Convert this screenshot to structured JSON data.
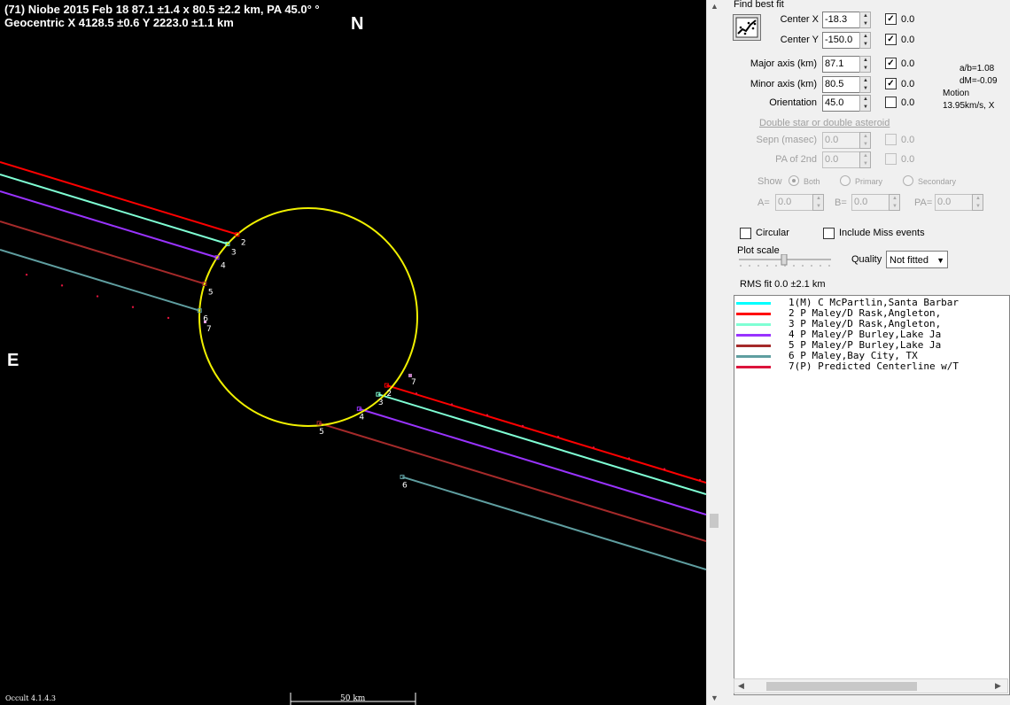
{
  "plot": {
    "title_line1": "(71) Niobe  2015 Feb 18   87.1 ±1.4 x 80.5 ±2.2 km, PA 45.0° °",
    "title_line2": "Geocentric  X  4128.5 ±0.6  Y 2223.0 ±1.1 km",
    "north_label": "N",
    "east_label": "E",
    "version": "Occult 4.1.4.3",
    "scale_label": "50 km",
    "ellipse_color": "#f0f000",
    "chord_labels": [
      "2",
      "3",
      "4",
      "5",
      "6",
      "7"
    ]
  },
  "panel": {
    "section_title": "Find best fit",
    "fit_button_icon": "scatter-fit-icon",
    "center_x": {
      "label": "Center X",
      "value": "-18.3",
      "checked": true,
      "adjust": "0.0"
    },
    "center_y": {
      "label": "Center Y",
      "value": "-150.0",
      "checked": true,
      "adjust": "0.0"
    },
    "major_axis": {
      "label": "Major axis (km)",
      "value": "87.1",
      "checked": true,
      "adjust": "0.0"
    },
    "minor_axis": {
      "label": "Minor axis (km)",
      "value": "80.5",
      "checked": true,
      "adjust": "0.0"
    },
    "orientation": {
      "label": "Orientation",
      "value": "45.0",
      "checked": false,
      "adjust": "0.0"
    },
    "ab_ratio": "a/b=1.08",
    "dm": "dM=-0.09",
    "motion_label": "Motion",
    "motion_value": "13.95km/s, X",
    "double_star_title": "Double star  or  double asteroid",
    "sepn": {
      "label": "Sepn (masec)",
      "value": "0.0",
      "adjust": "0.0"
    },
    "pa_2nd": {
      "label": "PA of 2nd",
      "value": "0.0",
      "adjust": "0.0"
    },
    "show_label": "Show",
    "show_options": [
      "Both",
      "Primary",
      "Secondary"
    ],
    "a_label": "A=",
    "a_value": "0.0",
    "b_label": "B=",
    "b_value": "0.0",
    "pa_label": "PA=",
    "pa_value": "0.0",
    "circular_label": "Circular",
    "include_miss_label": "Include Miss events",
    "plot_scale_label": "Plot scale",
    "quality_label": "Quality",
    "quality_value": "Not fitted",
    "rms_fit": "RMS fit 0.0 ±2.1 km"
  },
  "legend": [
    {
      "text": "1(M)  C McPartlin,Santa Barbar",
      "color": "#00ffff"
    },
    {
      "text": "2     P Maley/D Rask,Angleton,",
      "color": "#ff0000"
    },
    {
      "text": "3     P Maley/D Rask,Angleton,",
      "color": "#7fffd4"
    },
    {
      "text": "4     P Maley/P Burley,Lake Ja",
      "color": "#9933ff"
    },
    {
      "text": "5     P Maley/P Burley,Lake Ja",
      "color": "#a52a2a"
    },
    {
      "text": "6     P Maley,Bay City, TX",
      "color": "#5f9ea0"
    },
    {
      "text": "7(P)  Predicted Centerline w/T",
      "color": "#dc143c"
    }
  ]
}
